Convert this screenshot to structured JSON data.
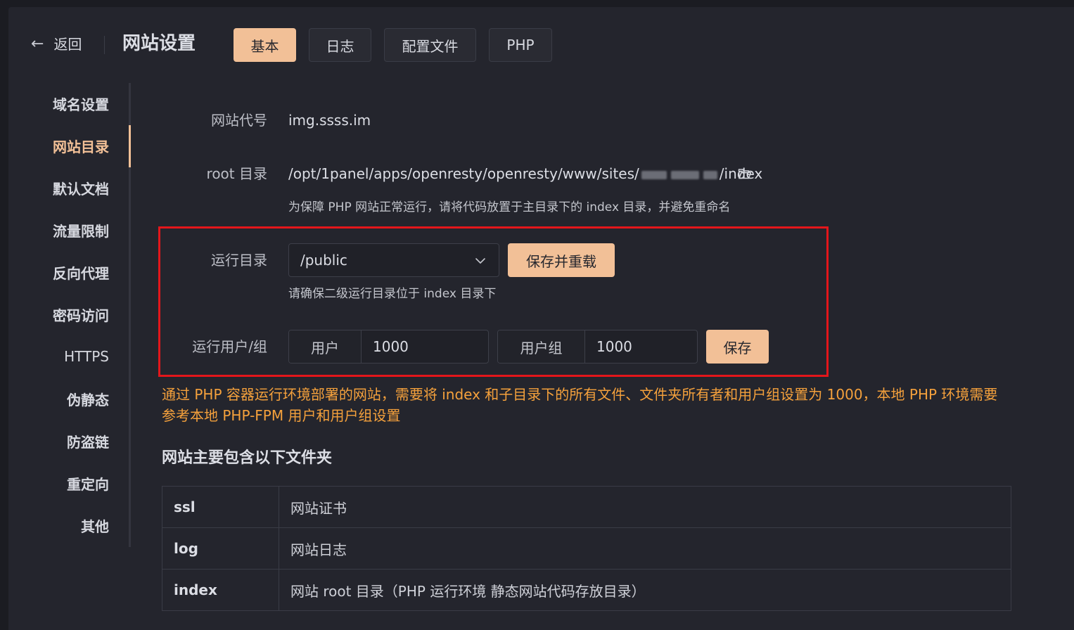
{
  "header": {
    "back_arrow": "←",
    "back_label": "返回",
    "title": "网站设置",
    "tabs": [
      {
        "label": "基本",
        "active": true
      },
      {
        "label": "日志",
        "active": false
      },
      {
        "label": "配置文件",
        "active": false
      },
      {
        "label": "PHP",
        "active": false
      }
    ]
  },
  "sidebar": {
    "items": [
      {
        "label": "域名设置",
        "active": false
      },
      {
        "label": "网站目录",
        "active": true
      },
      {
        "label": "默认文档",
        "active": false
      },
      {
        "label": "流量限制",
        "active": false
      },
      {
        "label": "反向代理",
        "active": false
      },
      {
        "label": "密码访问",
        "active": false
      },
      {
        "label": "HTTPS",
        "active": false
      },
      {
        "label": "伪静态",
        "active": false
      },
      {
        "label": "防盗链",
        "active": false
      },
      {
        "label": "重定向",
        "active": false
      },
      {
        "label": "其他",
        "active": false
      }
    ]
  },
  "form": {
    "site_code_label": "网站代号",
    "site_code_value": "img.ssss.im",
    "root_label": "root 目录",
    "root_prefix": "/opt/1panel/apps/openresty/openresty/www/sites/",
    "root_suffix": "/index",
    "root_hint": "为保障 PHP 网站正常运行，请将代码放置于主目录下的 index 目录，并避免重命名",
    "run_dir_label": "运行目录",
    "run_dir_value": "/public",
    "save_reload_label": "保存并重载",
    "run_dir_hint": "请确保二级运行目录位于 index 目录下",
    "run_user_label": "运行用户/组",
    "user_prefix": "用户",
    "user_value": "1000",
    "group_prefix": "用户组",
    "group_value": "1000",
    "save_label": "保存"
  },
  "warning": "通过 PHP 容器运行环境部署的网站，需要将 index 和子目录下的所有文件、文件夹所有者和用户组设置为 1000，本地 PHP 环境需要参考本地 PHP-FPM 用户和用户组设置",
  "folders": {
    "title": "网站主要包含以下文件夹",
    "rows": [
      {
        "name": "ssl",
        "desc": "网站证书"
      },
      {
        "name": "log",
        "desc": "网站日志"
      },
      {
        "name": "index",
        "desc": "网站 root 目录（PHP 运行环境 静态网站代码存放目录）"
      }
    ]
  },
  "colors": {
    "accent": "#f2c097",
    "warning": "#f5a13c",
    "highlight_box": "#e3161b",
    "background": "#24252d"
  }
}
